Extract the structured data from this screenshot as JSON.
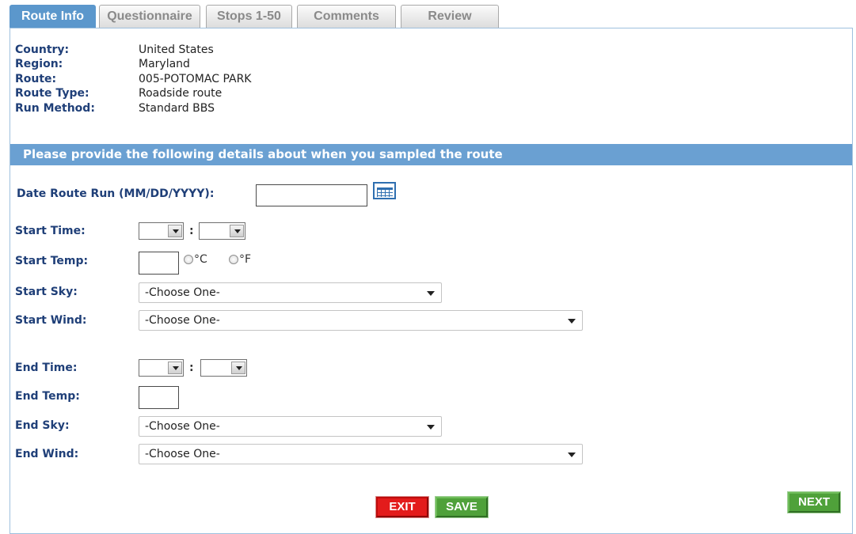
{
  "tabs": [
    {
      "label": "Route Info",
      "active": true
    },
    {
      "label": "Questionnaire",
      "active": false
    },
    {
      "label": "Stops 1-50",
      "active": false
    },
    {
      "label": "Comments",
      "active": false
    },
    {
      "label": "Review",
      "active": false
    }
  ],
  "summary": {
    "country_label": "Country:",
    "country": "United States",
    "region_label": "Region:",
    "region": "Maryland",
    "route_label": "Route:",
    "route": "005-POTOMAC PARK",
    "route_type_label": "Route Type:",
    "route_type": "Roadside route",
    "run_method_label": "Run Method:",
    "run_method": "Standard BBS"
  },
  "banner": "Please provide the following details about when you sampled the route",
  "form": {
    "date_label": "Date Route Run (MM/DD/YYYY):",
    "date_value": "",
    "start_time_label": "Start Time:",
    "start_temp_label": "Start Temp:",
    "temp_unit_c": "°C",
    "temp_unit_f": "°F",
    "start_sky_label": "Start Sky:",
    "start_sky_value": "-Choose One-",
    "start_wind_label": "Start Wind:",
    "start_wind_value": "-Choose One-",
    "end_time_label": "End Time:",
    "end_temp_label": "End Temp:",
    "end_sky_label": "End Sky:",
    "end_sky_value": "-Choose One-",
    "end_wind_label": "End Wind:",
    "end_wind_value": "-Choose One-",
    "time_separator": ":"
  },
  "buttons": {
    "exit": "EXIT",
    "save": "SAVE",
    "next": "NEXT"
  },
  "colors": {
    "tab_active": "#5b97cc",
    "banner": "#6aa0d2",
    "label": "#1f3f78",
    "exit": "#e31b1b",
    "save": "#4fa13a"
  },
  "icons": {
    "calendar": "calendar-icon"
  }
}
